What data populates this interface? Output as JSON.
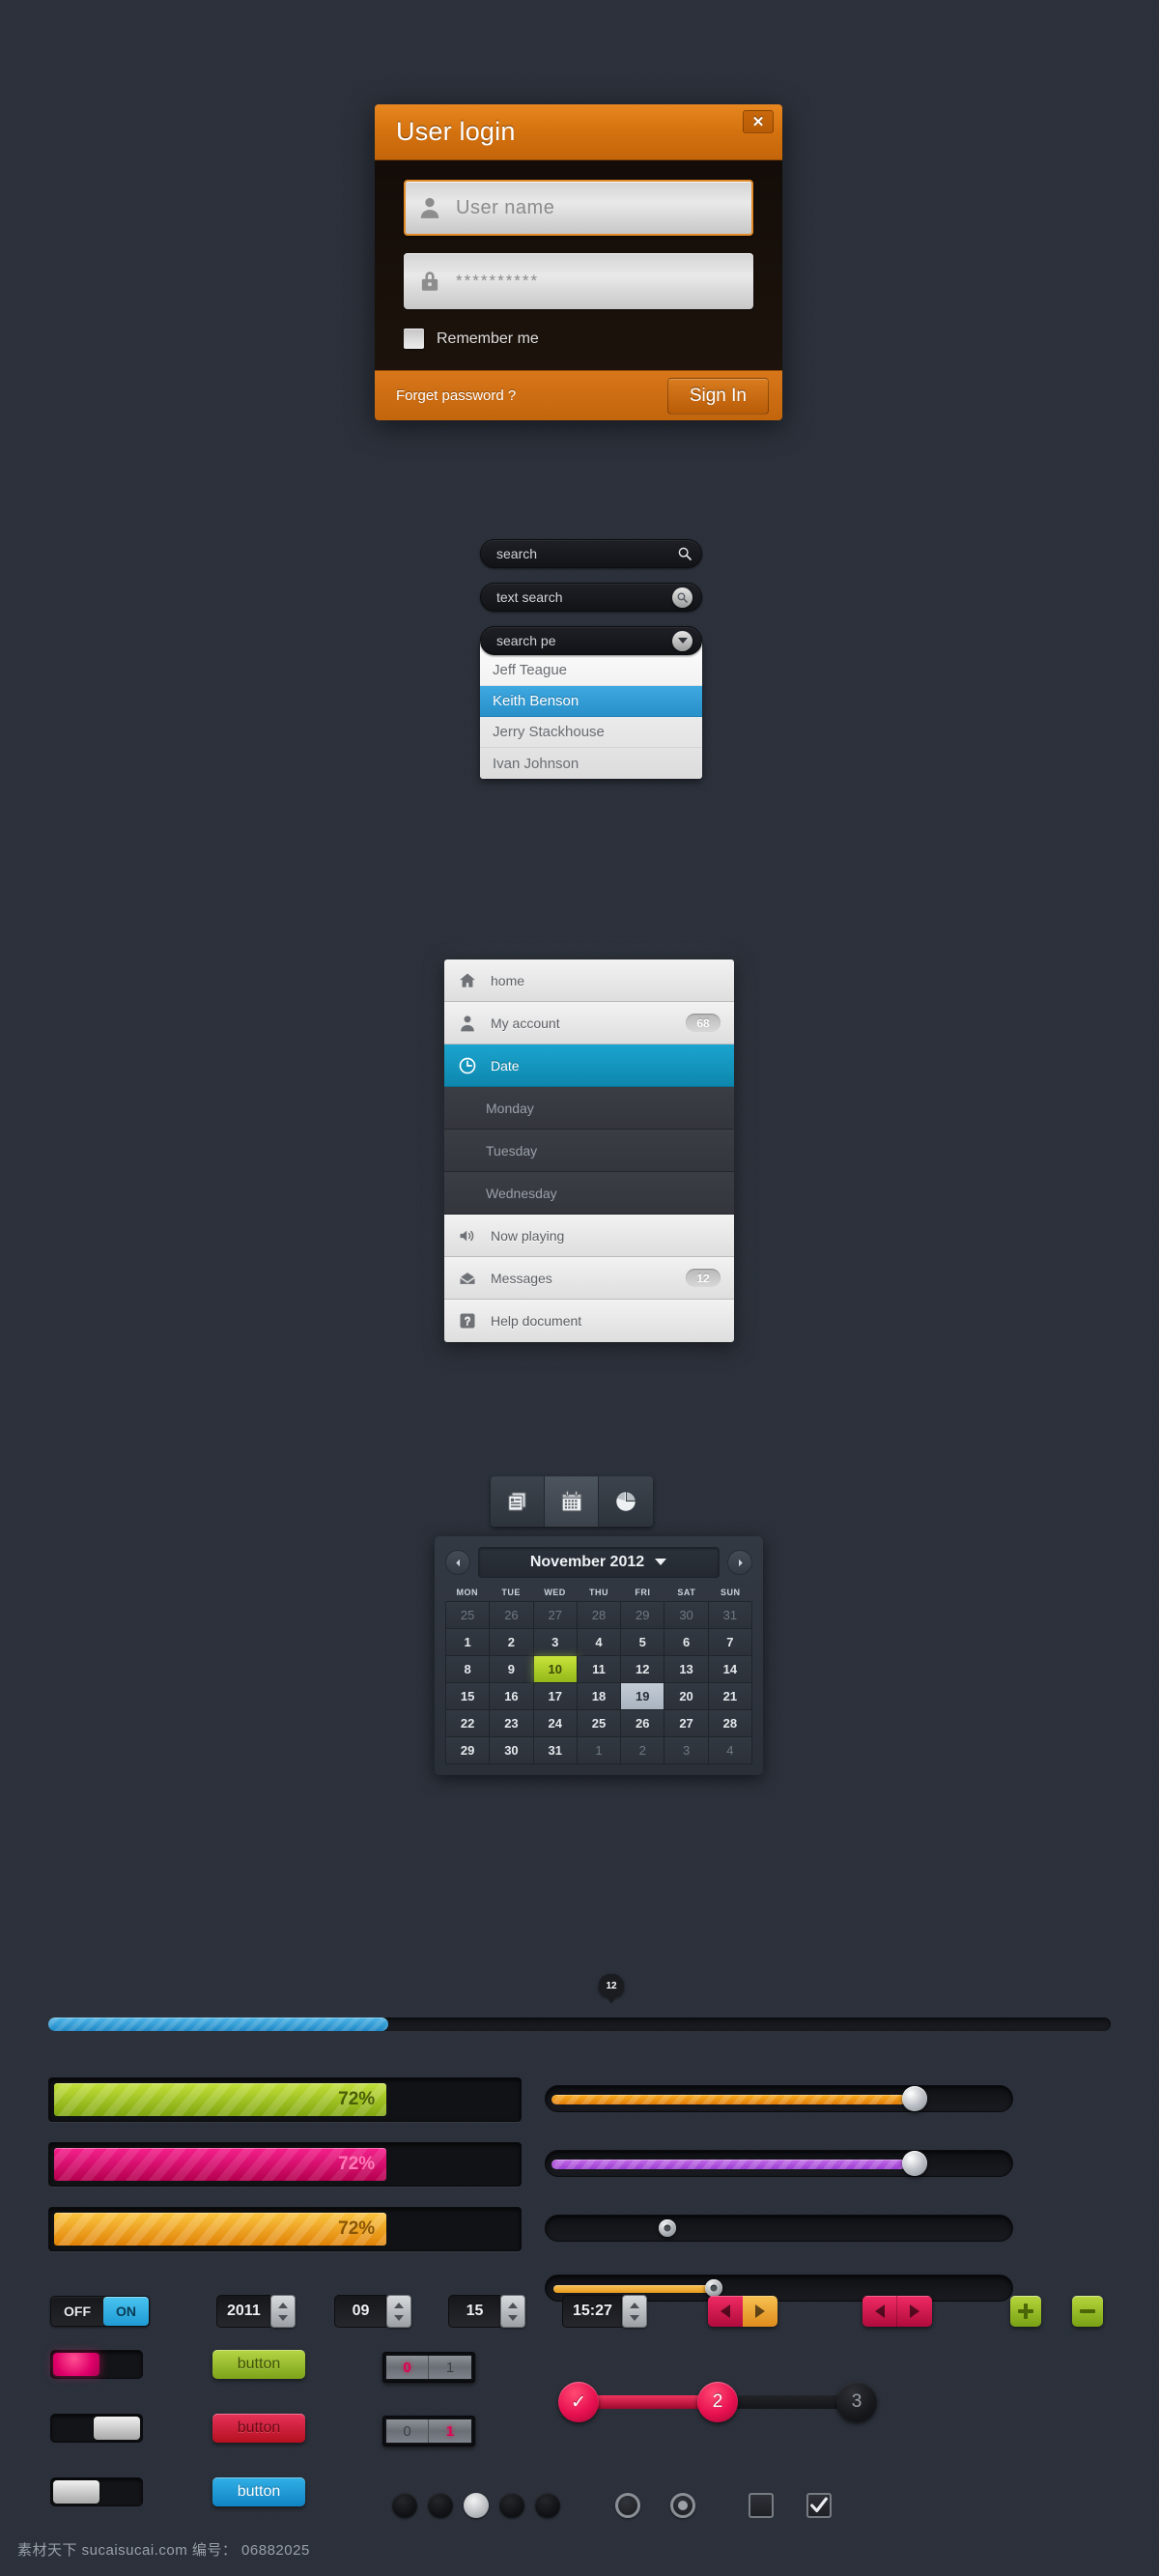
{
  "login": {
    "title": "User login",
    "close_label": "✕",
    "username_placeholder": "User name",
    "password_value": "**********",
    "remember_label": "Remember me",
    "forget_label": "Forget password ?",
    "signin_label": "Sign In",
    "accent_color": "#d4720f"
  },
  "search": {
    "plain": {
      "label": "search",
      "icon": "search-icon"
    },
    "text": {
      "label": "text search",
      "icon": "search-icon"
    },
    "dropdown": {
      "label": "search pe",
      "icon": "chevron-down-icon",
      "options": [
        "Jeff Teague",
        "Keith Benson",
        "Jerry Stackhouse",
        "Ivan Johnson"
      ],
      "selected": "Keith Benson",
      "highlight_color": "#2f9bd4"
    }
  },
  "nav": {
    "items": [
      {
        "label": "home",
        "icon": "home-icon",
        "badge": "",
        "style": "light"
      },
      {
        "label": "My account",
        "icon": "user-icon",
        "badge": "68",
        "style": "light"
      },
      {
        "label": "Date",
        "icon": "clock-icon",
        "badge": "",
        "style": "active"
      },
      {
        "label": "Monday",
        "icon": "",
        "badge": "",
        "style": "dark"
      },
      {
        "label": "Tuesday",
        "icon": "",
        "badge": "",
        "style": "dark"
      },
      {
        "label": "Wednesday",
        "icon": "",
        "badge": "",
        "style": "dark"
      },
      {
        "label": "Now playing",
        "icon": "speaker-icon",
        "badge": "",
        "style": "light"
      },
      {
        "label": "Messages",
        "icon": "envelope-icon",
        "badge": "12",
        "style": "light"
      },
      {
        "label": "Help document",
        "icon": "question-icon",
        "badge": "",
        "style": "light"
      }
    ],
    "active_color": "#0e87ae"
  },
  "calendar": {
    "toolbar": [
      {
        "icon": "documents-icon",
        "active": false
      },
      {
        "icon": "calendar-icon",
        "active": true
      },
      {
        "icon": "pie-chart-icon",
        "active": false
      }
    ],
    "month_label": "November 2012",
    "prev_label": "◀",
    "next_label": "▶",
    "weekdays": [
      "MON",
      "TUE",
      "WED",
      "THU",
      "FRI",
      "SAT",
      "SUN"
    ],
    "weeks": [
      [
        {
          "d": "25",
          "s": "muted"
        },
        {
          "d": "26",
          "s": "muted"
        },
        {
          "d": "27",
          "s": "muted"
        },
        {
          "d": "28",
          "s": "muted"
        },
        {
          "d": "29",
          "s": "muted"
        },
        {
          "d": "30",
          "s": "muted"
        },
        {
          "d": "31",
          "s": "muted"
        }
      ],
      [
        {
          "d": "1",
          "s": ""
        },
        {
          "d": "2",
          "s": ""
        },
        {
          "d": "3",
          "s": ""
        },
        {
          "d": "4",
          "s": ""
        },
        {
          "d": "5",
          "s": ""
        },
        {
          "d": "6",
          "s": ""
        },
        {
          "d": "7",
          "s": ""
        }
      ],
      [
        {
          "d": "8",
          "s": ""
        },
        {
          "d": "9",
          "s": ""
        },
        {
          "d": "10",
          "s": "today"
        },
        {
          "d": "11",
          "s": ""
        },
        {
          "d": "12",
          "s": ""
        },
        {
          "d": "13",
          "s": ""
        },
        {
          "d": "14",
          "s": ""
        }
      ],
      [
        {
          "d": "15",
          "s": ""
        },
        {
          "d": "16",
          "s": ""
        },
        {
          "d": "17",
          "s": ""
        },
        {
          "d": "18",
          "s": ""
        },
        {
          "d": "19",
          "s": "sel"
        },
        {
          "d": "20",
          "s": ""
        },
        {
          "d": "21",
          "s": ""
        }
      ],
      [
        {
          "d": "22",
          "s": ""
        },
        {
          "d": "23",
          "s": ""
        },
        {
          "d": "24",
          "s": ""
        },
        {
          "d": "25",
          "s": ""
        },
        {
          "d": "26",
          "s": ""
        },
        {
          "d": "27",
          "s": ""
        },
        {
          "d": "28",
          "s": ""
        }
      ],
      [
        {
          "d": "29",
          "s": ""
        },
        {
          "d": "30",
          "s": ""
        },
        {
          "d": "31",
          "s": ""
        },
        {
          "d": "1",
          "s": "muted"
        },
        {
          "d": "2",
          "s": "muted"
        },
        {
          "d": "3",
          "s": "muted"
        },
        {
          "d": "4",
          "s": "muted"
        }
      ]
    ],
    "today": "10",
    "selected": "19"
  },
  "progress": {
    "tooltip_value": "12",
    "blue_bar_percent": 32,
    "blue_color": "#2a93cc",
    "bars": [
      {
        "percent_label": "72%",
        "percent": 72,
        "color": "#9ec41c",
        "text_color": "#4a5e07"
      },
      {
        "percent_label": "72%",
        "percent": 72,
        "color": "#e0147a",
        "text_color": "#ff6bb0"
      },
      {
        "percent_label": "72%",
        "percent": 72,
        "color": "#f0a020",
        "text_color": "#8a5505"
      }
    ],
    "sliders": [
      {
        "fill_percent": 78,
        "color": "#f0960f",
        "knob": "large"
      },
      {
        "fill_percent": 78,
        "color": "#b455e0",
        "knob": "large"
      },
      {
        "fill_percent": 0,
        "color": "#000000",
        "knob": "small",
        "knob_percent": 26
      },
      {
        "fill_percent": 36,
        "color": "#f0aa33",
        "knob": "small",
        "knob_percent": 36
      }
    ]
  },
  "controls": {
    "onoff": {
      "off_label": "OFF",
      "on_label": "ON",
      "on_color": "#2aa5de"
    },
    "steppers": [
      {
        "value": "2011"
      },
      {
        "value": "09"
      },
      {
        "value": "15"
      },
      {
        "value": "15:27"
      }
    ],
    "updown_pairs": [
      {
        "left_color": "pink",
        "right_color": "orange"
      },
      {
        "left_color": "pink",
        "right_color": "pink"
      }
    ],
    "plus_label": "+",
    "minus_label": "−",
    "toggles": [
      {
        "state": "left-pink"
      },
      {
        "state": "right-gray"
      },
      {
        "state": "left-gray"
      }
    ],
    "buttons": [
      {
        "label": "button",
        "style": "green"
      },
      {
        "label": "button",
        "style": "red"
      },
      {
        "label": "button",
        "style": "blue"
      }
    ],
    "flippers": [
      {
        "cells": [
          {
            "v": "0",
            "hot": true
          },
          {
            "v": "1",
            "hot": false
          }
        ]
      },
      {
        "cells": [
          {
            "v": "0",
            "hot": false
          },
          {
            "v": "1",
            "hot": true
          }
        ]
      }
    ],
    "steps": [
      {
        "label": "✓",
        "state": "active"
      },
      {
        "label": "2",
        "state": "active"
      },
      {
        "label": "3",
        "state": "idle"
      }
    ],
    "dots": [
      {
        "on": false
      },
      {
        "on": false
      },
      {
        "on": true
      },
      {
        "on": false
      },
      {
        "on": false
      }
    ],
    "radios": [
      {
        "checked": false
      },
      {
        "checked": true
      }
    ],
    "checkboxes": [
      {
        "checked": false
      },
      {
        "checked": true
      }
    ]
  },
  "footer": {
    "text": "素材天下 sucaisucai.com  编号： 06882025"
  }
}
